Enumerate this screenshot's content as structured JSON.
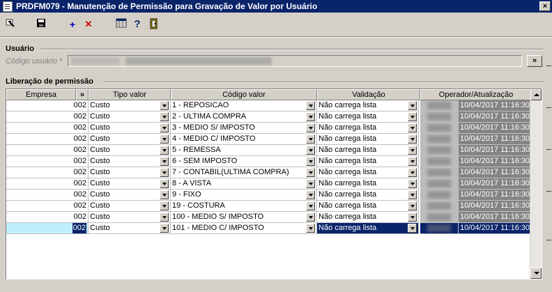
{
  "window": {
    "title": "PRDFM079 - Manutenção de Permissão para Gravação de Valor por Usuário",
    "close": "×"
  },
  "toolbar": {
    "add": "+",
    "delete": "✕",
    "help": "?"
  },
  "usuario": {
    "group_label": "Usuário",
    "field_label": "Código usuário *",
    "go": "»"
  },
  "grid": {
    "group_label": "Liberação de permissão",
    "headers": {
      "empresa": "Empresa",
      "expand": "»",
      "tipo_valor": "Tipo valor",
      "codigo_valor": "Código valor",
      "validacao": "Validação",
      "operador": "Operador/Atualização"
    },
    "rows": [
      {
        "empresa": "002",
        "tipo": "Custo",
        "codigo": "1 - REPOSICAO",
        "validacao": "Não carrega lista",
        "data": "10/04/2017 11:16:30"
      },
      {
        "empresa": "002",
        "tipo": "Custo",
        "codigo": "2 - ULTIMA COMPRA",
        "validacao": "Não carrega lista",
        "data": "10/04/2017 11:16:30"
      },
      {
        "empresa": "002",
        "tipo": "Custo",
        "codigo": "3 - MEDIO S/ IMPOSTO",
        "validacao": "Não carrega lista",
        "data": "10/04/2017 11:16:30"
      },
      {
        "empresa": "002",
        "tipo": "Custo",
        "codigo": "4 - MEDIO C/ IMPOSTO",
        "validacao": "Não carrega lista",
        "data": "10/04/2017 11:16:30"
      },
      {
        "empresa": "002",
        "tipo": "Custo",
        "codigo": "5 - REMESSA",
        "validacao": "Não carrega lista",
        "data": "10/04/2017 11:16:30"
      },
      {
        "empresa": "002",
        "tipo": "Custo",
        "codigo": "6 - SEM IMPOSTO",
        "validacao": "Não carrega lista",
        "data": "10/04/2017 11:16:30"
      },
      {
        "empresa": "002",
        "tipo": "Custo",
        "codigo": "7 - CONTABIL(ULTIMA COMPRA)",
        "validacao": "Não carrega lista",
        "data": "10/04/2017 11:16:30"
      },
      {
        "empresa": "002",
        "tipo": "Custo",
        "codigo": "8 - A VISTA",
        "validacao": "Não carrega lista",
        "data": "10/04/2017 11:16:30"
      },
      {
        "empresa": "002",
        "tipo": "Custo",
        "codigo": "9 - FIXO",
        "validacao": "Não carrega lista",
        "data": "10/04/2017 11:16:30"
      },
      {
        "empresa": "002",
        "tipo": "Custo",
        "codigo": "19 - COSTURA",
        "validacao": "Não carrega lista",
        "data": "10/04/2017 11:16:30"
      },
      {
        "empresa": "002",
        "tipo": "Custo",
        "codigo": "100 - MEDIO S/ IMPOSTO",
        "validacao": "Não carrega lista",
        "data": "10/04/2017 11:16:30"
      },
      {
        "empresa": "002",
        "tipo": "Custo",
        "codigo": "101 - MEDIO C/ IMPOSTO",
        "validacao": "Não carrega lista",
        "data": "10/04/2017 11:16:30",
        "selected": true
      }
    ]
  },
  "colors": {
    "title_bar": "#0a246a",
    "selection": "#0a246a",
    "empresa_highlight": "#bfeffd"
  }
}
